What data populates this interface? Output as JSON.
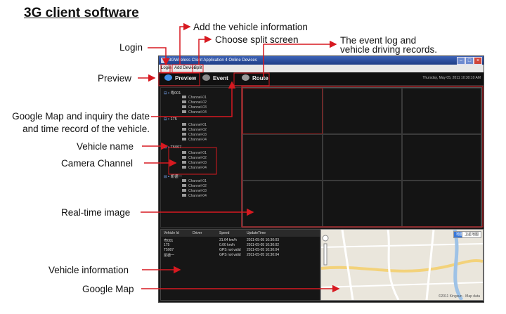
{
  "title": "3G client software",
  "annotations": {
    "login": "Login",
    "add_vehicle": "Add the vehicle information",
    "split_screen": "Choose split screen",
    "event_log_1": "The event log and",
    "event_log_2": "vehicle driving records.",
    "preview": "Preview",
    "google_map_inquiry_1": "Google Map and inquiry the date",
    "google_map_inquiry_2": "and time record of the vehicle.",
    "vehicle_name": "Vehicle name",
    "camera_channel": "Camera Channel",
    "realtime_image": "Real-time image",
    "vehicle_info": "Vehicle information",
    "google_map": "Google Map"
  },
  "app": {
    "window_title": "3GWireless Client Application    4 Online Devices",
    "menu": [
      "Login",
      "Add Device",
      "Split"
    ],
    "toolbar": [
      "Preview",
      "Event",
      "Route"
    ],
    "datetime": "Thursday, May 05, 2011  10:30:10 AM",
    "vehicles": [
      {
        "name": "粤001",
        "channels": [
          "Channel-01",
          "Channel-02",
          "Channel-03",
          "Channel-04"
        ]
      },
      {
        "name": "175",
        "channels": [
          "Channel-01",
          "Channel-02",
          "Channel-03",
          "Channel-04"
        ]
      },
      {
        "name": "T5007",
        "channels": [
          "Channel-01",
          "Channel-02",
          "Channel-03",
          "Channel-04"
        ]
      },
      {
        "name": "凯德一",
        "channels": [
          "Channel-01",
          "Channel-02",
          "Channel-03",
          "Channel-04"
        ]
      }
    ],
    "vehicle_table": {
      "headers": [
        "Vehicle Id",
        "Driver",
        "Speed",
        "UpdateTime"
      ],
      "rows": [
        [
          "粤001",
          "",
          "31.64 km/h",
          "2011-05-05 10:30:03"
        ],
        [
          "175",
          "",
          "0.00 km/h",
          "2011-05-05 10:30:02"
        ],
        [
          "T5007",
          "",
          "GPS not valid",
          "2011-05-05 10:30:04"
        ],
        [
          "凯德一",
          "",
          "GPS not valid",
          "2011-05-05 10:30:04"
        ]
      ]
    },
    "map": {
      "tab_map": "地图",
      "tab_satellite": "卫星地图",
      "footer": "©2011 Kingsun · Map data"
    }
  }
}
